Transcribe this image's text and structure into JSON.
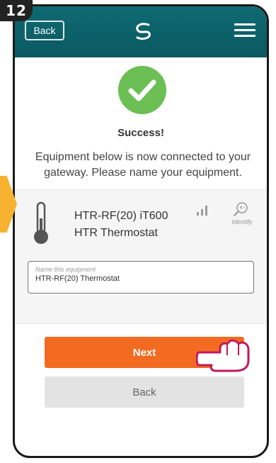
{
  "step": {
    "number": "12"
  },
  "header": {
    "back_label": "Back",
    "logo_icon": "salus-logo-icon",
    "menu_icon": "hamburger-menu-icon",
    "background": "#0f6a73"
  },
  "success": {
    "icon": "checkmark-circle-icon",
    "title": "Success!",
    "message": "Equipment below is now connected to your gateway. Please name your equipment.",
    "color": "#6cbf54"
  },
  "equipment": {
    "icon": "thermometer-icon",
    "model": "HTR-RF(20) iT600",
    "type": "HTR Thermostat",
    "signal_icon": "signal-strength-icon",
    "identify_icon": "identify-search-icon",
    "identify_label": "Identify",
    "name_field": {
      "label": "Name this equipment",
      "value": "HTR-RF(20) Thermostat"
    }
  },
  "actions": {
    "next_label": "Next",
    "back_label": "Back",
    "next_color": "#f26b21"
  },
  "annotations": {
    "side_arrow_color": "#f7b232",
    "pointer_icon": "hand-pointer-icon"
  }
}
